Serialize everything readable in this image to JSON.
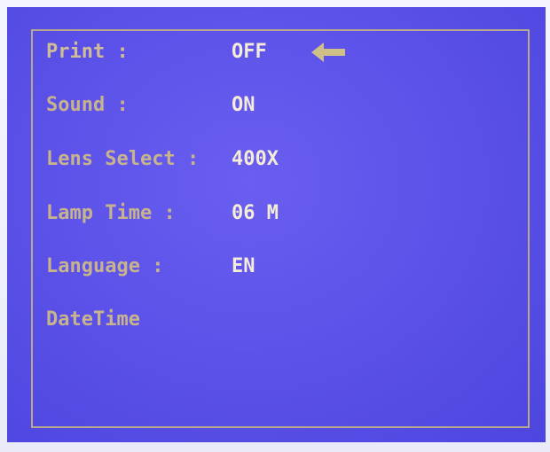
{
  "settings_menu": {
    "items": [
      {
        "label": "Print :",
        "value": "OFF",
        "selected": true
      },
      {
        "label": "Sound :",
        "value": "ON"
      },
      {
        "label": "Lens Select :",
        "value": "400X"
      },
      {
        "label": "Lamp Time :",
        "value": "06 M"
      },
      {
        "label": "Language :",
        "value": "EN"
      },
      {
        "label": "DateTime",
        "value": ""
      }
    ],
    "selection_indicator": "left-arrow-icon"
  },
  "colors": {
    "screen_background": "#5a50e8",
    "label_text": "#c7b48d",
    "value_text": "#f4ecd6",
    "frame_border": "#b9a98c",
    "arrow": "#cfc087"
  }
}
